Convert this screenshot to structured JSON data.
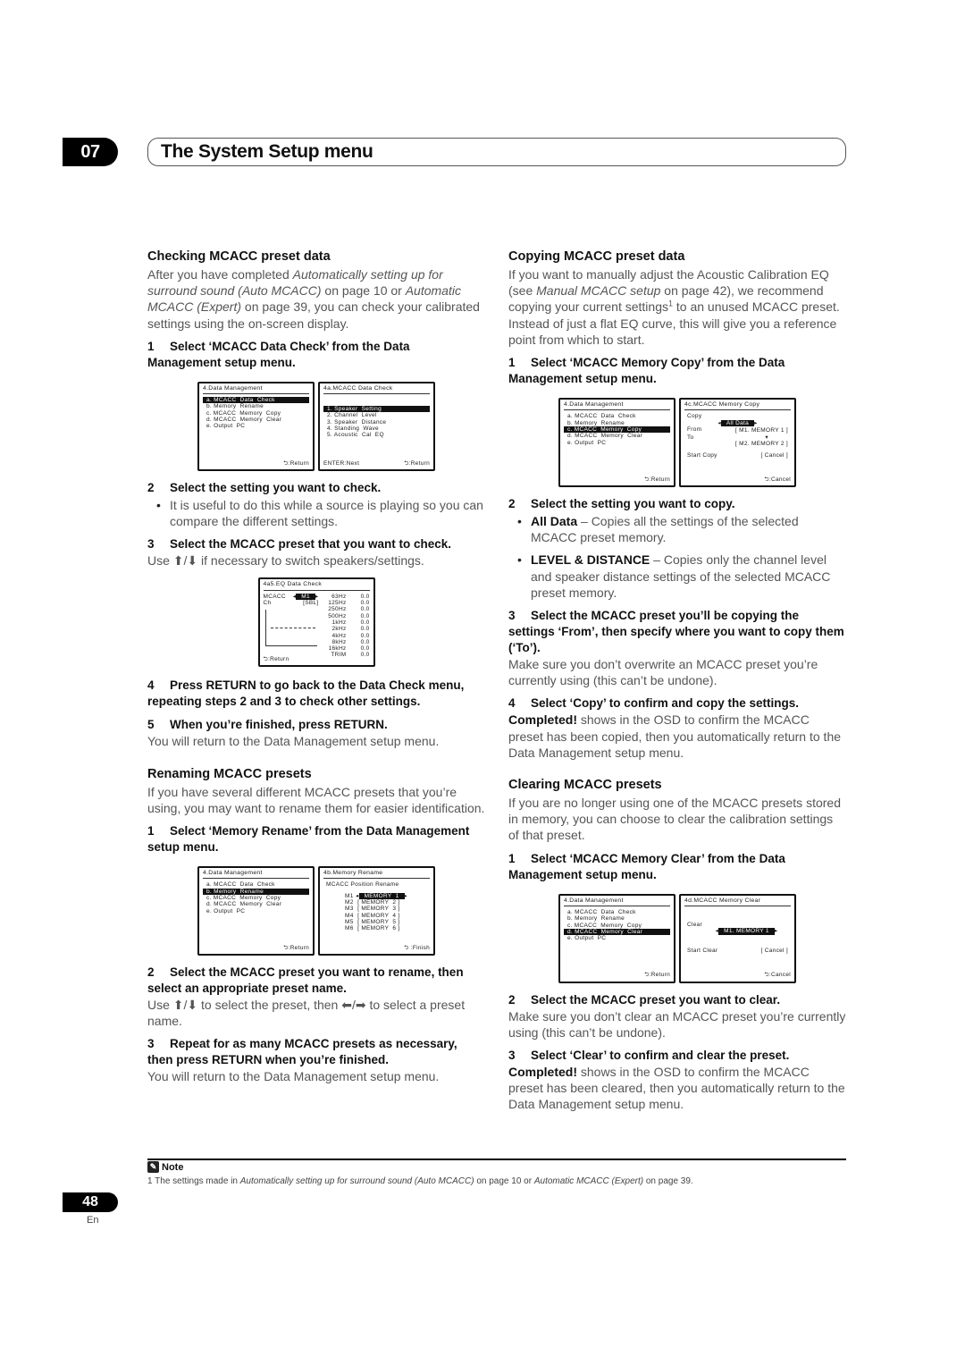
{
  "header": {
    "chapter_number": "07",
    "chapter_title": "The System Setup menu"
  },
  "left": {
    "checking": {
      "heading": "Checking MCACC preset data",
      "intro_parts": [
        "After you have completed ",
        "Automatically setting up for surround sound (Auto MCACC)",
        " on page 10 or ",
        "Automatic MCACC (Expert)",
        " on page 39, you can check your calibrated settings using the on-screen display."
      ],
      "step1": {
        "num": "1",
        "text": "Select ‘MCACC Data Check’ from the Data Management setup menu."
      },
      "step2": {
        "num": "2",
        "text": "Select the setting you want to check."
      },
      "step2_bullet": "It is useful to do this while a source is playing so you can compare the different settings.",
      "step3": {
        "num": "3",
        "text": "Select the MCACC preset that you want to check."
      },
      "step3_body": "Use ⬆/⬇ if necessary to switch speakers/settings.",
      "step4": {
        "num": "4",
        "text": "Press RETURN to go back to the Data Check menu, repeating steps 2 and 3 to check other settings."
      },
      "step5": {
        "num": "5",
        "text": "When you’re finished, press RETURN."
      },
      "step5_body": "You will return to the Data Management setup menu."
    },
    "renaming": {
      "heading": "Renaming MCACC presets",
      "intro": "If you have several different MCACC presets that you’re using, you may want to rename them for easier identification.",
      "step1": {
        "num": "1",
        "text": "Select ‘Memory Rename’ from the Data Management setup menu."
      },
      "step2": {
        "num": "2",
        "text": "Select the MCACC preset you want to rename, then select an appropriate preset name."
      },
      "step2_body": "Use ⬆/⬇ to select the preset, then ⬅/➡ to select a preset name.",
      "step3": {
        "num": "3",
        "text": "Repeat for as many MCACC presets as necessary, then press RETURN when you’re finished."
      },
      "step3_body": "You will return to the Data Management setup menu."
    }
  },
  "right": {
    "copying": {
      "heading": "Copying MCACC preset data",
      "intro_parts": [
        "If you want to manually adjust the Acoustic Calibration EQ (see ",
        "Manual MCACC setup",
        " on page 42), we recommend copying your current settings",
        "1",
        " to an unused MCACC preset. Instead of just a flat EQ curve, this will give you a reference point from which to start."
      ],
      "step1": {
        "num": "1",
        "text": "Select ‘MCACC Memory Copy’ from the Data Management setup menu."
      },
      "step2": {
        "num": "2",
        "text": "Select the setting you want to copy."
      },
      "bullets": [
        {
          "term": "All Data",
          "desc": " – Copies all the settings of the selected MCACC preset memory."
        },
        {
          "term": "LEVEL & DISTANCE",
          "desc": " – Copies only the channel level and speaker distance settings of the selected MCACC preset memory."
        }
      ],
      "step3": {
        "num": "3",
        "text": "Select the MCACC preset you’ll be copying the settings ‘From’, then specify where you want to copy them (‘To’)."
      },
      "step3_body": "Make sure you don’t overwrite an MCACC preset you’re currently using (this can’t be undone).",
      "step4": {
        "num": "4",
        "text": "Select ‘Copy’ to confirm and copy the settings."
      },
      "step4_bold": "Completed!",
      "step4_body": " shows in the OSD to confirm the MCACC preset has been copied, then you automatically return to the Data Management setup menu."
    },
    "clearing": {
      "heading": "Clearing MCACC presets",
      "intro": "If you are no longer using one of the MCACC presets stored in memory, you can choose to clear the calibration settings of that preset.",
      "step1": {
        "num": "1",
        "text": "Select ‘MCACC Memory Clear’ from the Data Management setup menu."
      },
      "step2": {
        "num": "2",
        "text": "Select the MCACC preset you want to clear."
      },
      "step2_body": "Make sure you don’t clear an MCACC preset you’re currently using (this can’t be undone).",
      "step3": {
        "num": "3",
        "text": "Select ‘Clear’ to confirm and clear the preset."
      },
      "step3_bold": "Completed!",
      "step3_body": " shows in the OSD to confirm the MCACC preset has been cleared, then you automatically return to the Data Management setup menu."
    }
  },
  "osd": {
    "data_management": {
      "title": "4.Data  Management",
      "items": [
        "a. MCACC  Data  Check",
        "b. Memory  Rename",
        "c. MCACC  Memory  Copy",
        "d. MCACC  Memory  Clear",
        "e. Output  PC"
      ],
      "return": "⮌:Return"
    },
    "data_check": {
      "title": "4a.MCACC  Data  Check",
      "items": [
        "1. Speaker  Setting",
        "2. Channel  Level",
        "3. Speaker  Distance",
        "4. Standing  Wave",
        "5. Acoustic  Cal  EQ"
      ],
      "next": "ENTER:Next",
      "return": "⮌:Return"
    },
    "eq_check": {
      "title": "4a5.EQ  Data  Check",
      "mcacc_label": "MCACC",
      "mcacc_value": "M1",
      "ch_label": "Ch",
      "ch_value": "[SBL]",
      "rows": [
        {
          "freq": "63Hz",
          "val": "0.0"
        },
        {
          "freq": "125Hz",
          "val": "0.0"
        },
        {
          "freq": "250Hz",
          "val": "0.0"
        },
        {
          "freq": "500Hz",
          "val": "0.0"
        },
        {
          "freq": "1kHz",
          "val": "0.0"
        },
        {
          "freq": "2kHz",
          "val": "0.0"
        },
        {
          "freq": "4kHz",
          "val": "0.0"
        },
        {
          "freq": "8kHz",
          "val": "0.0"
        },
        {
          "freq": "16kHz",
          "val": "0.0"
        },
        {
          "freq": "TRIM",
          "val": "0.0"
        }
      ],
      "return": "⮌:Return"
    },
    "rename": {
      "title": "4b.Memory  Rename",
      "subtitle": "MCACC  Position  Rename",
      "rows": [
        {
          "pos": "M1",
          "name": "MEMORY  1"
        },
        {
          "pos": "M2",
          "name": "MEMORY  2"
        },
        {
          "pos": "M3",
          "name": "MEMORY  3"
        },
        {
          "pos": "M4",
          "name": "MEMORY  4"
        },
        {
          "pos": "M5",
          "name": "MEMORY  5"
        },
        {
          "pos": "M6",
          "name": "MEMORY  6"
        }
      ],
      "finish": "⮌ :Finish"
    },
    "copy": {
      "title": "4c.MCACC  Memory  Copy",
      "copy_label": "Copy",
      "copy_value": "All Data",
      "from_label": "From",
      "from_value": "[ M1. MEMORY 1 ]",
      "to_label": "To",
      "to_value": "[ M2. MEMORY 2 ]",
      "start_label": "Start Copy",
      "start_value": "[ Cancel ]",
      "cancel": "⮌:Cancel"
    },
    "clear": {
      "title": "4d.MCACC  Memory  Clear",
      "clear_label": "Clear",
      "clear_value": "M1. MEMORY 1",
      "start_label": "Start Clear",
      "start_value": "[ Cancel ]",
      "cancel": "⮌:Cancel"
    }
  },
  "footer": {
    "note_label": "Note",
    "footnote_parts": [
      "1 The settings made in ",
      "Automatically setting up for surround sound (Auto MCACC)",
      " on page 10 or ",
      "Automatic MCACC (Expert)",
      " on page 39."
    ],
    "page_number": "48",
    "language": "En"
  }
}
